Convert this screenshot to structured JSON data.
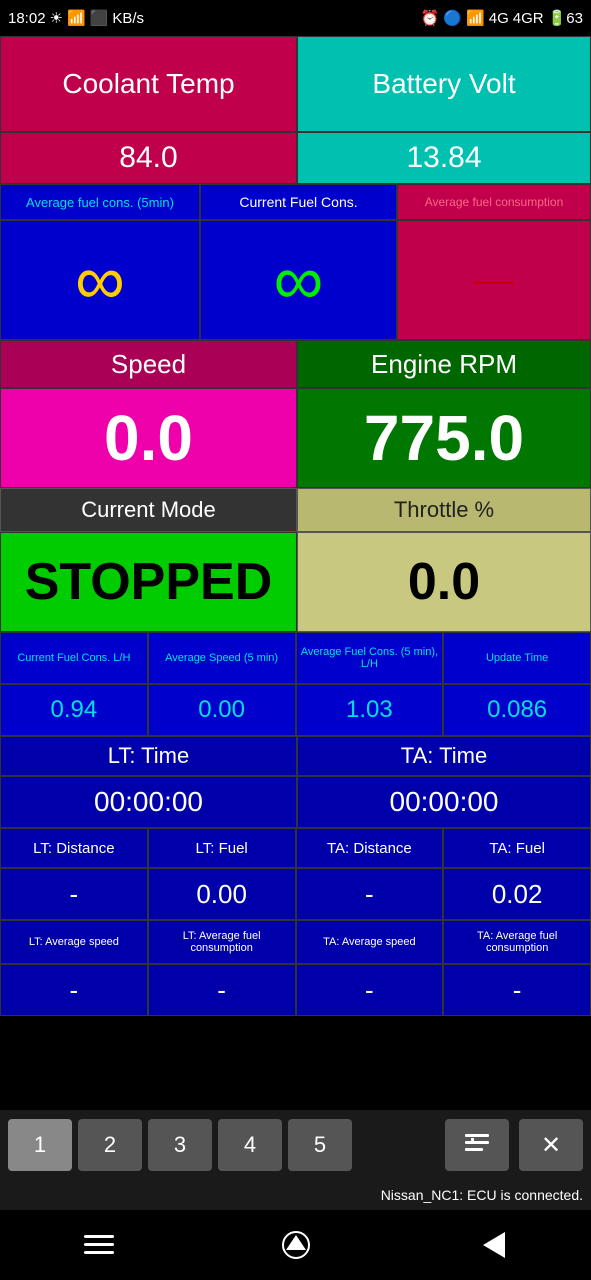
{
  "statusBar": {
    "time": "18:02",
    "icons": "battery wifi signal"
  },
  "row1": {
    "coolantLabel": "Coolant Temp",
    "batteryLabel": "Battery Volt"
  },
  "row2": {
    "coolantVal": "84.0",
    "batteryVal": "13.84"
  },
  "row3": {
    "avgFuelLabel": "Average fuel cons. (5min)",
    "currFuelLabel": "Current Fuel Cons.",
    "avgFuelConsLabel": "Average fuel consumption"
  },
  "row4": {
    "avgFuelVal": "∞",
    "currFuelVal": "∞",
    "avgFuelConsVal": "—"
  },
  "row5": {
    "speedLabel": "Speed",
    "rpmLabel": "Engine RPM"
  },
  "row6": {
    "speedVal": "0.0",
    "rpmVal": "775.0"
  },
  "row7": {
    "modeLabel": "Current Mode",
    "throttleLabel": "Throttle %"
  },
  "row8": {
    "modeVal": "STOPPED",
    "throttleVal": "0.0"
  },
  "row9": {
    "stat1Label": "Current Fuel Cons. L/H",
    "stat2Label": "Average Speed (5 min)",
    "stat3Label": "Average Fuel Cons. (5 min), L/H",
    "stat4Label": "Update Time"
  },
  "row10": {
    "stat1Val": "0.94",
    "stat2Val": "0.00",
    "stat3Val": "1.03",
    "stat4Val": "0.086"
  },
  "row11": {
    "ltTimeLabel": "LT: Time",
    "taTimeLabel": "TA: Time"
  },
  "row12": {
    "ltTimeVal": "00:00:00",
    "taTimeVal": "00:00:00"
  },
  "row13": {
    "ltDistLabel": "LT: Distance",
    "ltFuelLabel": "LT: Fuel",
    "taDistLabel": "TA: Distance",
    "taFuelLabel": "TA: Fuel"
  },
  "row14": {
    "ltDistVal": "-",
    "ltFuelVal": "0.00",
    "taDistVal": "-",
    "taFuelVal": "0.02"
  },
  "row15": {
    "ltAvgSpeedLabel": "LT: Average speed",
    "ltAvgFuelLabel": "LT: Average fuel consumption",
    "taAvgSpeedLabel": "TA: Average speed",
    "taAvgFuelLabel": "TA: Average fuel consumption"
  },
  "row16": {
    "ltAvgSpeedVal": "-",
    "ltAvgFuelVal": "-",
    "taAvgSpeedVal": "-",
    "taAvgFuelVal": "-"
  },
  "toolbar": {
    "tab1": "1",
    "tab2": "2",
    "tab3": "3",
    "tab4": "4",
    "tab5": "5",
    "tabIconList": "≡",
    "tabClose": "✕"
  },
  "connection": {
    "status": "Nissan_NC1: ECU is connected."
  }
}
